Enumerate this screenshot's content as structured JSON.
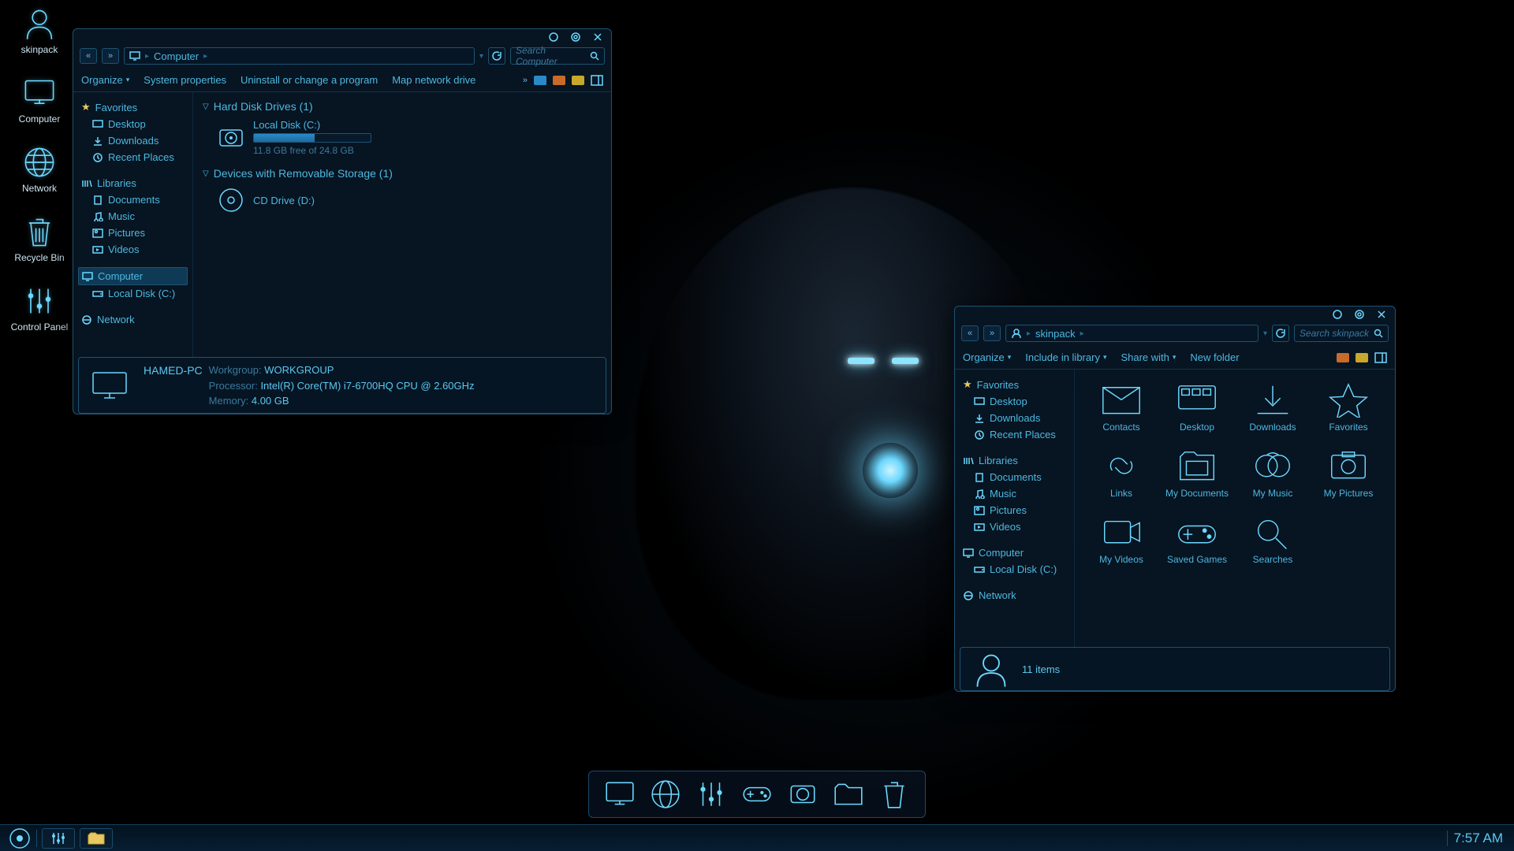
{
  "desktop": {
    "icons": [
      {
        "name": "skinpack",
        "label": "skinpack"
      },
      {
        "name": "computer",
        "label": "Computer"
      },
      {
        "name": "network",
        "label": "Network"
      },
      {
        "name": "recycle-bin",
        "label": "Recycle Bin"
      },
      {
        "name": "control-panel",
        "label": "Control Panel"
      }
    ]
  },
  "window_computer": {
    "breadcrumb": {
      "root": "Computer"
    },
    "search_placeholder": "Search Computer",
    "toolbar": {
      "organize": "Organize",
      "system_properties": "System properties",
      "uninstall": "Uninstall or change a program",
      "map_drive": "Map network drive"
    },
    "sidebar": {
      "favorites": {
        "label": "Favorites",
        "items": [
          "Desktop",
          "Downloads",
          "Recent Places"
        ]
      },
      "libraries": {
        "label": "Libraries",
        "items": [
          "Documents",
          "Music",
          "Pictures",
          "Videos"
        ]
      },
      "computer": {
        "label": "Computer",
        "items": [
          "Local Disk (C:)"
        ]
      },
      "network": {
        "label": "Network"
      }
    },
    "sections": {
      "hdd": {
        "label": "Hard Disk Drives (1)"
      },
      "removable": {
        "label": "Devices with Removable Storage (1)"
      }
    },
    "drives": {
      "c": {
        "name": "Local Disk (C:)",
        "free": "11.8 GB free of 24.8 GB",
        "fill_pct": 52
      },
      "cd": {
        "name": "CD Drive (D:)"
      }
    },
    "status": {
      "name": "HAMED-PC",
      "workgroup_lbl": "Workgroup:",
      "workgroup": "WORKGROUP",
      "processor_lbl": "Processor:",
      "processor": "Intel(R) Core(TM) i7-6700HQ CPU @ 2.60GHz",
      "memory_lbl": "Memory:",
      "memory": "4.00 GB"
    }
  },
  "window_skinpack": {
    "breadcrumb": {
      "root": "skinpack"
    },
    "search_placeholder": "Search skinpack",
    "toolbar": {
      "organize": "Organize",
      "include": "Include in library",
      "share": "Share with",
      "new_folder": "New folder"
    },
    "sidebar": {
      "favorites": {
        "label": "Favorites",
        "items": [
          "Desktop",
          "Downloads",
          "Recent Places"
        ]
      },
      "libraries": {
        "label": "Libraries",
        "items": [
          "Documents",
          "Music",
          "Pictures",
          "Videos"
        ]
      },
      "computer": {
        "label": "Computer",
        "items": [
          "Local Disk (C:)"
        ]
      },
      "network": {
        "label": "Network"
      }
    },
    "folders": [
      "Contacts",
      "Desktop",
      "Downloads",
      "Favorites",
      "Links",
      "My Documents",
      "My Music",
      "My Pictures",
      "My Videos",
      "Saved Games",
      "Searches"
    ],
    "status": {
      "count": "11 items"
    }
  },
  "taskbar": {
    "time": "7:57 AM"
  }
}
